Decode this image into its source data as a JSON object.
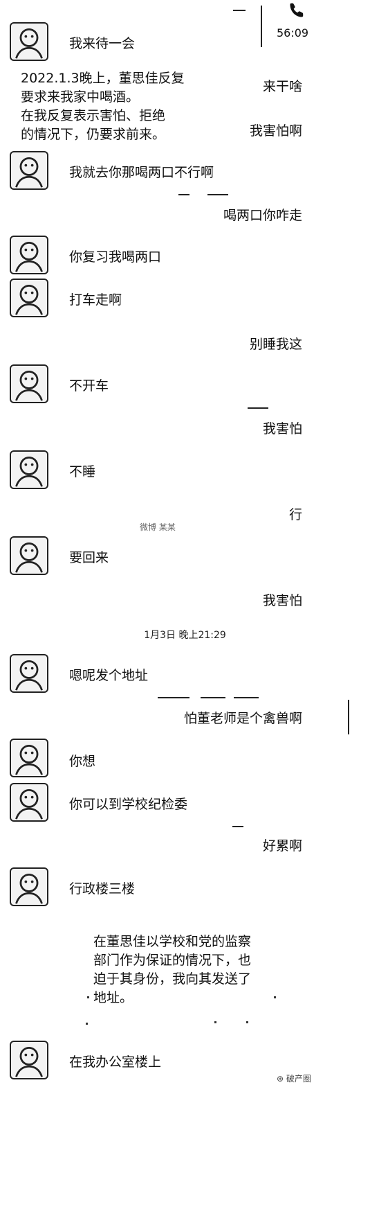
{
  "status": {
    "duration": "56:09",
    "phone_icon": "phone-icon"
  },
  "note_top": {
    "line1": "2022.1.3晚上，董思佳反复",
    "line2": "要求来我家中喝酒。",
    "line3": "在我反复表示害怕、拒绝",
    "line4": "的情况下，仍要求前来。"
  },
  "note_bottom": {
    "line1": "在董思佳以学校和党的监察",
    "line2": "部门作为保证的情况下，也",
    "line3": "迫于其身份，我向其发送了",
    "line4": "地址。"
  },
  "messages": [
    {
      "side": "in",
      "text": "我来待一会"
    },
    {
      "side": "out",
      "text": "来干啥"
    },
    {
      "side": "out",
      "text": "我害怕啊"
    },
    {
      "side": "in",
      "text": "我就去你那喝两口不行啊"
    },
    {
      "side": "out",
      "text": "喝两口你咋走"
    },
    {
      "side": "in",
      "text": "你复习我喝两口"
    },
    {
      "side": "in",
      "text": "打车走啊"
    },
    {
      "side": "out",
      "text": "别睡我这"
    },
    {
      "side": "in",
      "text": "不开车"
    },
    {
      "side": "out",
      "text": "我害怕"
    },
    {
      "side": "in",
      "text": "不睡"
    },
    {
      "side": "out",
      "text": "行"
    },
    {
      "side": "in",
      "text": "要回来"
    },
    {
      "side": "out",
      "text": "我害怕"
    },
    {
      "side": "in",
      "text": "嗯呢发个地址"
    },
    {
      "side": "out",
      "text": "怕董老师是个禽兽啊"
    },
    {
      "side": "in",
      "text": "你想"
    },
    {
      "side": "in",
      "text": "你可以到学校纪检委"
    },
    {
      "side": "out",
      "text": "好累啊"
    },
    {
      "side": "in",
      "text": "行政楼三楼"
    },
    {
      "side": "in",
      "text": "在我办公室楼上"
    }
  ],
  "timestamp": "1月3日 晚上21:29",
  "watermark_mid": "微博 某某",
  "watermark_bottom": "破产圈",
  "colors": {
    "background": "#ffffff",
    "text": "#111111"
  }
}
